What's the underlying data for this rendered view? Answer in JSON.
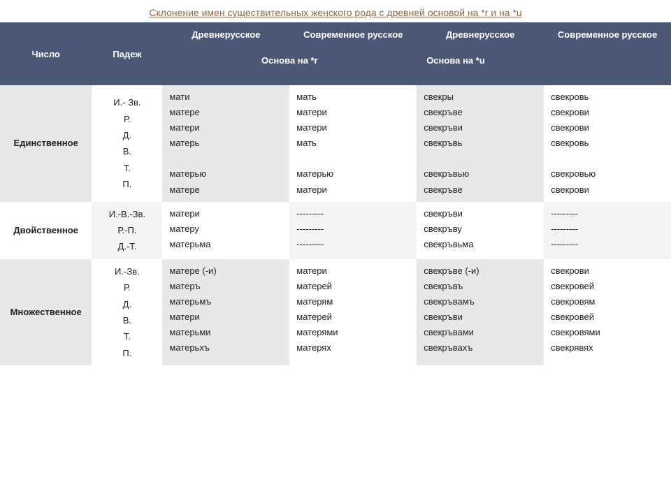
{
  "title": "Склонение имен существительных женского рода с древней основой на *r  и  на *u",
  "header": {
    "number": "Число",
    "case": "Падеж",
    "old_ru": "Древнерусское",
    "mod_ru": "Современное русское",
    "stem_r": "Основа на *r",
    "stem_u": "Основа на *u"
  },
  "rows": {
    "sing_label": "Единственное",
    "dual_label": "Двойственное",
    "plur_label": "Множественное",
    "sing_cases": "И.- Зв.\nР.\nД.\nВ.\nТ.\nП.",
    "dual_cases": "И.-В.-Зв.\nР.-П.\nД.-Т.",
    "plur_cases": "И.-Зв.\nР.\nД.\nВ.\nТ.\nП."
  },
  "data": {
    "sing": {
      "or_r": "мати\nматере\nматери\nматерь\n \nматерью\nматере",
      "mr_r": "мать\nматери\nматери\nмать\n \nматерью\nматери",
      "or_u": "свекры\nсвекръве\nсвекръви\nсвекръвь\n \nсвекръвью\nсвекръве",
      "mr_u": "свекровь\nсвекрови\nсвекрови\nсвекровь\n \nсвекровью\nсвекрови"
    },
    "dual": {
      "or_r": "матери\nматеру\nматерьма",
      "mr_r": "---------\n---------\n---------",
      "or_u": "свекръви\nсвекръву\nсвекръвьма",
      "mr_u": "---------\n---------\n---------"
    },
    "plur": {
      "or_r": "матере (-и)\n матеръ\nматерьмъ\nматери\n матерьми\nматерьхъ",
      "mr_r": "матери\n матерей\nматерям\nматерей\n матерями\nматерях",
      "or_u": "свекръве (-и)\nсвекръвъ\nсвекръвамъ\nсвекръви\nсвекръвами\nсвекръвахъ",
      "mr_u": "свекрови\nсвекровей\nсвекровям\nсвекровей\nсвекровями\nсвекрявях"
    }
  }
}
